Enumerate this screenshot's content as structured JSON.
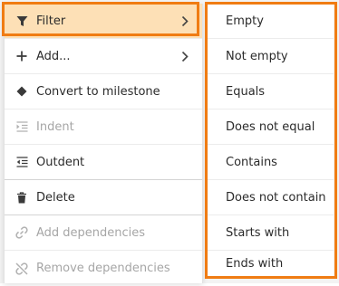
{
  "context_menu": {
    "items": [
      {
        "label": "Filter",
        "icon": "filter-icon",
        "submenu": true,
        "state": "active"
      },
      {
        "label": "Add...",
        "icon": "plus-icon",
        "submenu": true,
        "state": "enabled"
      },
      {
        "label": "Convert to milestone",
        "icon": "diamond-icon",
        "submenu": false,
        "state": "enabled"
      },
      {
        "label": "Indent",
        "icon": "indent-icon",
        "submenu": false,
        "state": "disabled"
      },
      {
        "label": "Outdent",
        "icon": "outdent-icon",
        "submenu": false,
        "state": "enabled"
      },
      {
        "label": "Delete",
        "icon": "trash-icon",
        "submenu": false,
        "state": "enabled"
      },
      {
        "label": "Add dependencies",
        "icon": "link-icon",
        "submenu": false,
        "state": "disabled"
      },
      {
        "label": "Remove dependencies",
        "icon": "unlink-icon",
        "submenu": false,
        "state": "disabled"
      }
    ]
  },
  "filter_submenu": {
    "items": [
      {
        "label": "Empty"
      },
      {
        "label": "Not empty"
      },
      {
        "label": "Equals"
      },
      {
        "label": "Does not equal"
      },
      {
        "label": "Contains"
      },
      {
        "label": "Does not contain"
      },
      {
        "label": "Starts with"
      },
      {
        "label": "Ends with"
      }
    ]
  },
  "colors": {
    "highlight_border": "#f07c13",
    "active_item_bg": "#fde0b6"
  }
}
